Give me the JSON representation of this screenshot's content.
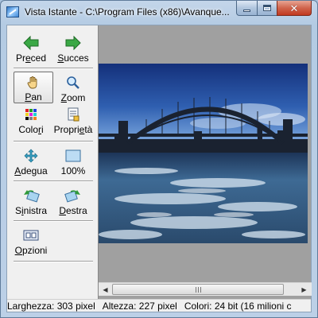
{
  "window": {
    "title": "Vista Istante - C:\\Program Files (x86)\\Avanque..."
  },
  "toolbar": {
    "buttons": [
      {
        "id": "precedente",
        "label_pre": "Pr",
        "label_u": "e",
        "label_post": "ced",
        "icon": "arrow-left-green-icon"
      },
      {
        "id": "successivo",
        "label_pre": "",
        "label_u": "S",
        "label_post": "ucces",
        "icon": "arrow-right-green-icon"
      },
      {
        "id": "pan",
        "label_pre": "",
        "label_u": "P",
        "label_post": "an",
        "icon": "hand-icon",
        "active": true
      },
      {
        "id": "zoom",
        "label_pre": "",
        "label_u": "Z",
        "label_post": "oom",
        "icon": "magnifier-icon"
      },
      {
        "id": "colori",
        "label_pre": "Colo",
        "label_u": "r",
        "label_post": "i",
        "icon": "color-grid-icon"
      },
      {
        "id": "proprieta",
        "label_pre": "Propri",
        "label_u": "e",
        "label_post": "tà",
        "icon": "properties-icon"
      },
      {
        "id": "adegua",
        "label_pre": "",
        "label_u": "A",
        "label_post": "degua",
        "icon": "fit-arrows-icon"
      },
      {
        "id": "cento",
        "label_pre": "100%",
        "label_u": "",
        "label_post": "",
        "icon": "actual-size-icon"
      },
      {
        "id": "sinistra",
        "label_pre": "S",
        "label_u": "i",
        "label_post": "nistra",
        "icon": "rotate-left-icon"
      },
      {
        "id": "destra",
        "label_pre": "",
        "label_u": "D",
        "label_post": "estra",
        "icon": "rotate-right-icon"
      },
      {
        "id": "opzioni",
        "label_pre": "",
        "label_u": "O",
        "label_post": "pzioni",
        "icon": "options-icon"
      }
    ]
  },
  "status": {
    "larghezza": "Larghezza: 303 pixel",
    "altezza": "Altezza: 227 pixel",
    "colori": "Colori: 24 bit (16 milioni c"
  },
  "colors": {
    "accent_green": "#2f9a3a",
    "sky_top": "#1c3a8a",
    "water": "#3e6f9c"
  }
}
